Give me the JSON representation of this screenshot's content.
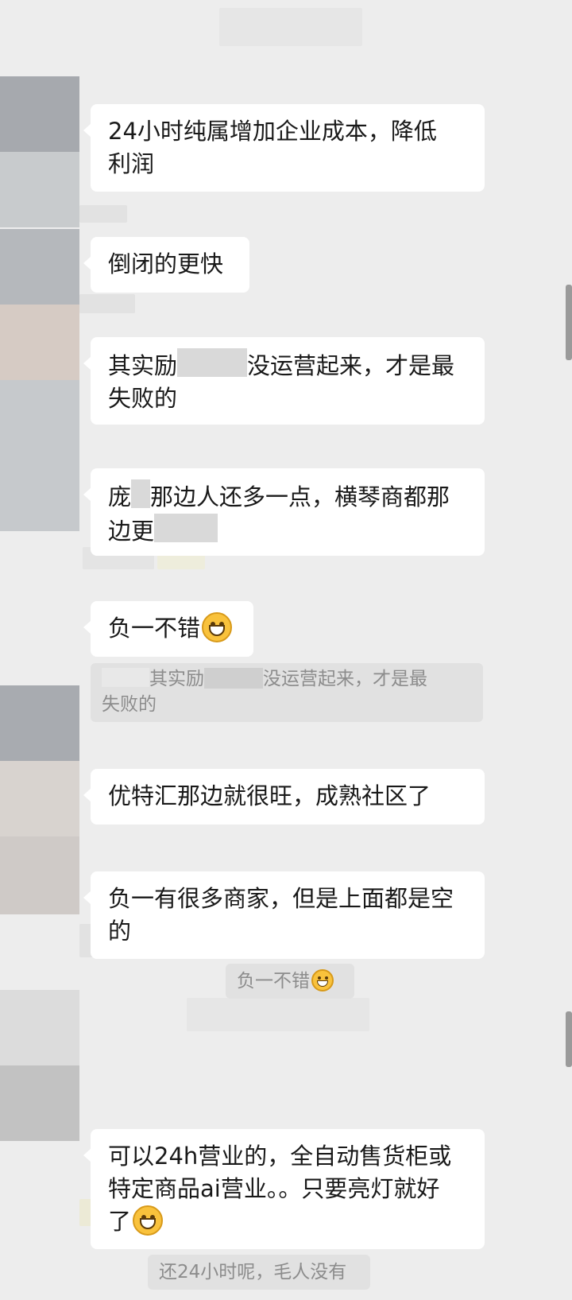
{
  "messages": [
    {
      "lines": [
        "24小时纯属增加企业成本，降低",
        "利润"
      ]
    },
    {
      "lines": [
        "倒闭的更快"
      ]
    },
    {
      "line1_before": "其实励",
      "line1_after": "没运营起来，才是最",
      "line2": "失败的"
    },
    {
      "line1_before": "庞",
      "line1_after": "那边人还多一点，横琴商都那",
      "line2_before": "边更"
    },
    {
      "text": "负一不错",
      "emoji": "smirk-emoji"
    },
    {
      "lines": [
        "优特汇那边就很旺，成熟社区了"
      ]
    },
    {
      "lines": [
        "负一有很多商家，但是上面都是空",
        "的"
      ]
    },
    {
      "lines": [
        "可以24h营业的，全自动售货柜或",
        "特定商品ai营业。。只要亮灯就好"
      ],
      "last_line": "了",
      "emoji": "grin-emoji"
    }
  ],
  "quotes": [
    {
      "line1_before": "其实励",
      "line1_after": "没运营起来，才是最",
      "line2": "失败的"
    },
    {
      "text": "负一不错",
      "emoji": "smirk-emoji"
    },
    {
      "text": "还24小时呢，毛人没有"
    }
  ],
  "colors": {
    "background": "#ededed",
    "bubble": "#ffffff",
    "quote_bg": "#e1e1e1",
    "text": "#191919",
    "quote_text": "#8c8c8c"
  }
}
